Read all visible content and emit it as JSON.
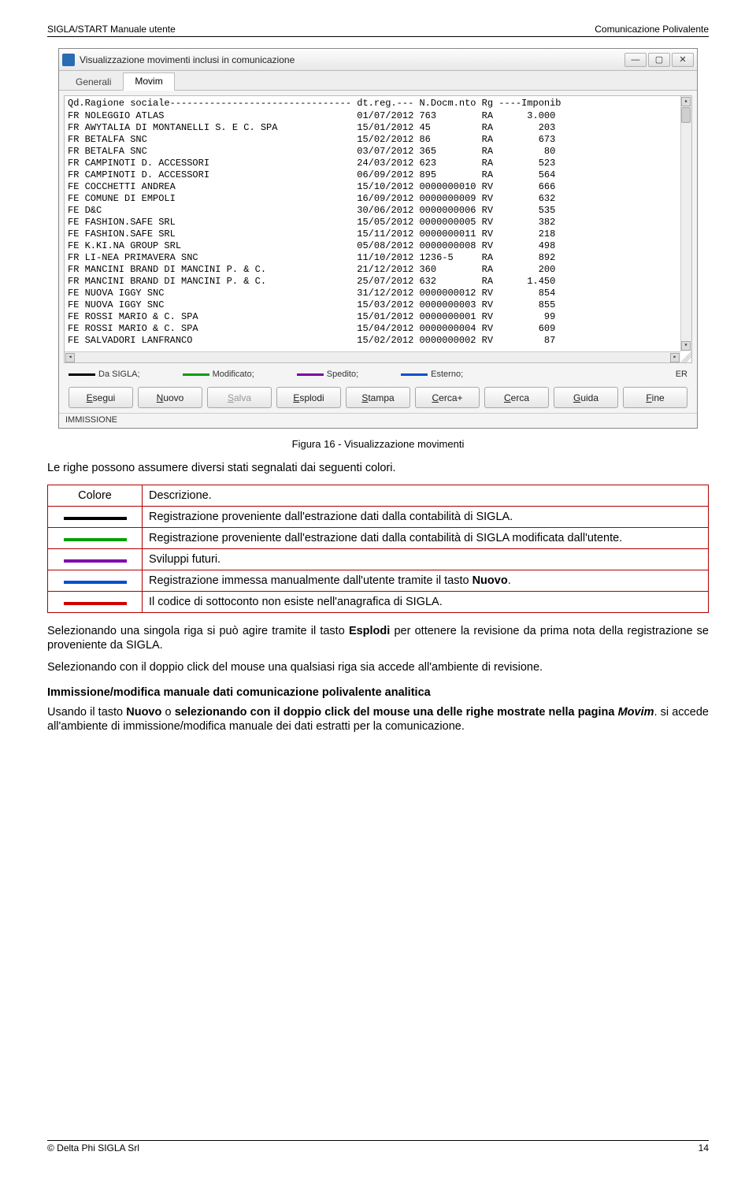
{
  "header": {
    "left": "SIGLA/START Manuale utente",
    "right": "Comunicazione Polivalente"
  },
  "footer": {
    "left": "© Delta Phi SIGLA Srl",
    "right": "14"
  },
  "window": {
    "title": "Visualizzazione movimenti inclusi in comunicazione",
    "tabs": [
      "Generali",
      "Movim"
    ],
    "active_tab": 1,
    "grid_header": "Qd.Ragione sociale-------------------------------- dt.reg.--- N.Docm.nto Rg ----Imponib",
    "rows": [
      {
        "qd": "FR",
        "ragione": "NOLEGGIO ATLAS",
        "dt": "01/07/2012",
        "ndoc": "763",
        "rg": "RA",
        "imp": "3.000"
      },
      {
        "qd": "FR",
        "ragione": "AWYTALIA DI MONTANELLI S. E C. SPA",
        "dt": "15/01/2012",
        "ndoc": "45",
        "rg": "RA",
        "imp": "203"
      },
      {
        "qd": "FR",
        "ragione": "BETALFA SNC",
        "dt": "15/02/2012",
        "ndoc": "86",
        "rg": "RA",
        "imp": "673"
      },
      {
        "qd": "FR",
        "ragione": "BETALFA SNC",
        "dt": "03/07/2012",
        "ndoc": "365",
        "rg": "RA",
        "imp": "80"
      },
      {
        "qd": "FR",
        "ragione": "CAMPINOTI D. ACCESSORI",
        "dt": "24/03/2012",
        "ndoc": "623",
        "rg": "RA",
        "imp": "523"
      },
      {
        "qd": "FR",
        "ragione": "CAMPINOTI D. ACCESSORI",
        "dt": "06/09/2012",
        "ndoc": "895",
        "rg": "RA",
        "imp": "564"
      },
      {
        "qd": "FE",
        "ragione": "COCCHETTI ANDREA",
        "dt": "15/10/2012",
        "ndoc": "0000000010",
        "rg": "RV",
        "imp": "666"
      },
      {
        "qd": "FE",
        "ragione": "COMUNE DI EMPOLI",
        "dt": "16/09/2012",
        "ndoc": "0000000009",
        "rg": "RV",
        "imp": "632"
      },
      {
        "qd": "FE",
        "ragione": "D&C",
        "dt": "30/06/2012",
        "ndoc": "0000000006",
        "rg": "RV",
        "imp": "535"
      },
      {
        "qd": "FE",
        "ragione": "FASHION.SAFE SRL",
        "dt": "15/05/2012",
        "ndoc": "0000000005",
        "rg": "RV",
        "imp": "382"
      },
      {
        "qd": "FE",
        "ragione": "FASHION.SAFE SRL",
        "dt": "15/11/2012",
        "ndoc": "0000000011",
        "rg": "RV",
        "imp": "218"
      },
      {
        "qd": "FE",
        "ragione": "K.KI.NA GROUP SRL",
        "dt": "05/08/2012",
        "ndoc": "0000000008",
        "rg": "RV",
        "imp": "498"
      },
      {
        "qd": "FR",
        "ragione": "LI-NEA PRIMAVERA SNC",
        "dt": "11/10/2012",
        "ndoc": "1236-5",
        "rg": "RA",
        "imp": "892"
      },
      {
        "qd": "FR",
        "ragione": "MANCINI BRAND DI MANCINI P. & C.",
        "dt": "21/12/2012",
        "ndoc": "360",
        "rg": "RA",
        "imp": "200"
      },
      {
        "qd": "FR",
        "ragione": "MANCINI BRAND DI MANCINI P. & C.",
        "dt": "25/07/2012",
        "ndoc": "632",
        "rg": "RA",
        "imp": "1.450"
      },
      {
        "qd": "FE",
        "ragione": "NUOVA IGGY SNC",
        "dt": "31/12/2012",
        "ndoc": "0000000012",
        "rg": "RV",
        "imp": "854"
      },
      {
        "qd": "FE",
        "ragione": "NUOVA IGGY SNC",
        "dt": "15/03/2012",
        "ndoc": "0000000003",
        "rg": "RV",
        "imp": "855"
      },
      {
        "qd": "FE",
        "ragione": "ROSSI MARIO & C. SPA",
        "dt": "15/01/2012",
        "ndoc": "0000000001",
        "rg": "RV",
        "imp": "99"
      },
      {
        "qd": "FE",
        "ragione": "ROSSI MARIO & C. SPA",
        "dt": "15/04/2012",
        "ndoc": "0000000004",
        "rg": "RV",
        "imp": "609"
      },
      {
        "qd": "FE",
        "ragione": "SALVADORI LANFRANCO",
        "dt": "15/02/2012",
        "ndoc": "0000000002",
        "rg": "RV",
        "imp": "87"
      }
    ],
    "legend": [
      {
        "color": "#000000",
        "label": "Da SIGLA;"
      },
      {
        "color": "#00a000",
        "label": "Modificato;"
      },
      {
        "color": "#8000a0",
        "label": "Spedito;"
      },
      {
        "color": "#0050d0",
        "label": "Esterno;"
      }
    ],
    "er_label": "ER",
    "buttons": [
      "Esegui",
      "Nuovo",
      "Salva",
      "Esplodi",
      "Stampa",
      "Cerca+",
      "Cerca",
      "Guida",
      "Fine"
    ],
    "disabled_button_index": 2,
    "status": "IMMISSIONE"
  },
  "caption": "Figura 16 - Visualizzazione movimenti",
  "intro": "Le righe possono assumere diversi stati segnalati dai seguenti colori.",
  "table": {
    "h1": "Colore",
    "h2": "Descrizione.",
    "rows": [
      {
        "color": "#000000",
        "desc": "Registrazione proveniente dall'estrazione dati dalla contabilità di SIGLA."
      },
      {
        "color": "#00a000",
        "desc": "Registrazione proveniente dall'estrazione dati dalla contabilità di SIGLA modificata dall'utente."
      },
      {
        "color": "#8000b0",
        "desc": "Sviluppi futuri."
      },
      {
        "color": "#0050d0",
        "desc_pre": "Registrazione immessa manualmente dall'utente tramite il tasto ",
        "desc_bold": "Nuovo",
        "desc_post": "."
      },
      {
        "color": "#d00000",
        "desc": "Il codice di sottoconto non esiste nell'anagrafica di SIGLA."
      }
    ]
  },
  "p1_pre": "Selezionando una singola riga si può agire tramite il tasto ",
  "p1_bold": "Esplodi",
  "p1_post": " per ottenere la revisione da prima nota della registrazione se proveniente da SIGLA.",
  "p2": "Selezionando con il doppio click del mouse una qualsiasi riga sia accede all'ambiente di revisione.",
  "sect": "Immissione/modifica manuale dati comunicazione polivalente analitica",
  "p3_a": "Usando il tasto ",
  "p3_b": "Nuovo",
  "p3_c": " o ",
  "p3_d": "selezionando con il doppio click del mouse una delle righe mostrate nella pagina ",
  "p3_e": "Movim",
  "p3_f": ". si accede all'ambiente di immissione/modifica manuale dei dati estratti per la comunicazione."
}
